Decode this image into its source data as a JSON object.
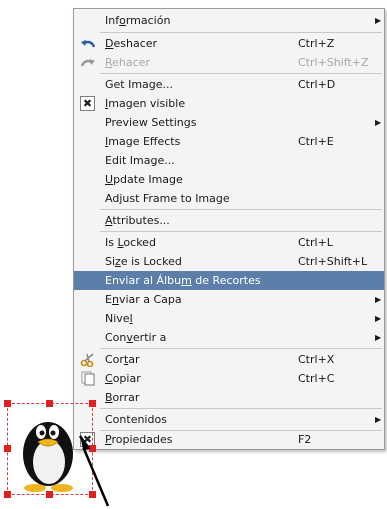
{
  "context_menu": {
    "items": [
      {
        "id": "informacion",
        "pre": "Inf",
        "ul": "o",
        "post": "rmación",
        "shortcut": "",
        "submenu": true,
        "icon": null,
        "state": "normal"
      },
      {
        "id": "deshacer",
        "pre": "",
        "ul": "D",
        "post": "eshacer",
        "shortcut": "Ctrl+Z",
        "submenu": false,
        "icon": "undo-icon",
        "state": "normal"
      },
      {
        "id": "rehacer",
        "pre": "",
        "ul": "R",
        "post": "ehacer",
        "shortcut": "Ctrl+Shift+Z",
        "submenu": false,
        "icon": "redo-icon",
        "state": "disabled"
      },
      {
        "id": "get-image",
        "pre": "Get Image...",
        "ul": "",
        "post": "",
        "shortcut": "Ctrl+D",
        "submenu": false,
        "icon": null,
        "state": "normal"
      },
      {
        "id": "imagen-visible",
        "pre": "",
        "ul": "I",
        "post": "magen visible",
        "shortcut": "",
        "submenu": false,
        "icon": "checked-checkbox",
        "state": "normal"
      },
      {
        "id": "preview-settings",
        "pre": "Preview Settings",
        "ul": "",
        "post": "",
        "shortcut": "",
        "submenu": true,
        "icon": null,
        "state": "normal"
      },
      {
        "id": "image-effects",
        "pre": "",
        "ul": "I",
        "post": "mage Effects",
        "shortcut": "Ctrl+E",
        "submenu": false,
        "icon": null,
        "state": "normal"
      },
      {
        "id": "edit-image",
        "pre": "Edit Image...",
        "ul": "",
        "post": "",
        "shortcut": "",
        "submenu": false,
        "icon": null,
        "state": "normal"
      },
      {
        "id": "update-image",
        "pre": "",
        "ul": "U",
        "post": "pdate Image",
        "shortcut": "",
        "submenu": false,
        "icon": null,
        "state": "normal"
      },
      {
        "id": "adjust-frame",
        "pre": "Adjust Frame to Image",
        "ul": "",
        "post": "",
        "shortcut": "",
        "submenu": false,
        "icon": null,
        "state": "normal"
      },
      {
        "id": "attributes",
        "pre": "",
        "ul": "A",
        "post": "ttributes...",
        "shortcut": "",
        "submenu": false,
        "icon": null,
        "state": "normal"
      },
      {
        "id": "is-locked",
        "pre": "Is ",
        "ul": "L",
        "post": "ocked",
        "shortcut": "Ctrl+L",
        "submenu": false,
        "icon": null,
        "state": "normal"
      },
      {
        "id": "size-is-locked",
        "pre": "Si",
        "ul": "z",
        "post": "e is Locked",
        "shortcut": "Ctrl+Shift+L",
        "submenu": false,
        "icon": null,
        "state": "normal"
      },
      {
        "id": "enviar-album",
        "pre": "Enviar al Álbu",
        "ul": "m",
        "post": " de Recortes",
        "shortcut": "",
        "submenu": false,
        "icon": null,
        "state": "highlighted"
      },
      {
        "id": "enviar-capa",
        "pre": "E",
        "ul": "n",
        "post": "viar a Capa",
        "shortcut": "",
        "submenu": true,
        "icon": null,
        "state": "normal"
      },
      {
        "id": "nivel",
        "pre": "Nive",
        "ul": "l",
        "post": "",
        "shortcut": "",
        "submenu": true,
        "icon": null,
        "state": "normal"
      },
      {
        "id": "convertir",
        "pre": "Con",
        "ul": "v",
        "post": "ertir a",
        "shortcut": "",
        "submenu": true,
        "icon": null,
        "state": "normal"
      },
      {
        "id": "cortar",
        "pre": "Cor",
        "ul": "t",
        "post": "ar",
        "shortcut": "Ctrl+X",
        "submenu": false,
        "icon": "scissors-icon",
        "state": "normal"
      },
      {
        "id": "copiar",
        "pre": "",
        "ul": "C",
        "post": "opiar",
        "shortcut": "Ctrl+C",
        "submenu": false,
        "icon": "copy-icon",
        "state": "normal"
      },
      {
        "id": "borrar",
        "pre": "",
        "ul": "B",
        "post": "orrar",
        "shortcut": "",
        "submenu": false,
        "icon": null,
        "state": "normal"
      },
      {
        "id": "contenidos",
        "pre": "Contenidos",
        "ul": "",
        "post": "",
        "shortcut": "",
        "submenu": true,
        "icon": null,
        "state": "normal"
      },
      {
        "id": "propiedades",
        "pre": "",
        "ul": "P",
        "post": "ropiedades",
        "shortcut": "F2",
        "submenu": false,
        "icon": "checked-checkbox",
        "state": "normal"
      }
    ]
  },
  "canvas": {
    "selected_image": "tux-penguin-image",
    "selection_color": "#e02020"
  },
  "colors": {
    "menu_bg": "#f4f4f4",
    "highlight": "#5b7fa9",
    "disabled_text": "#a8a8a8"
  }
}
